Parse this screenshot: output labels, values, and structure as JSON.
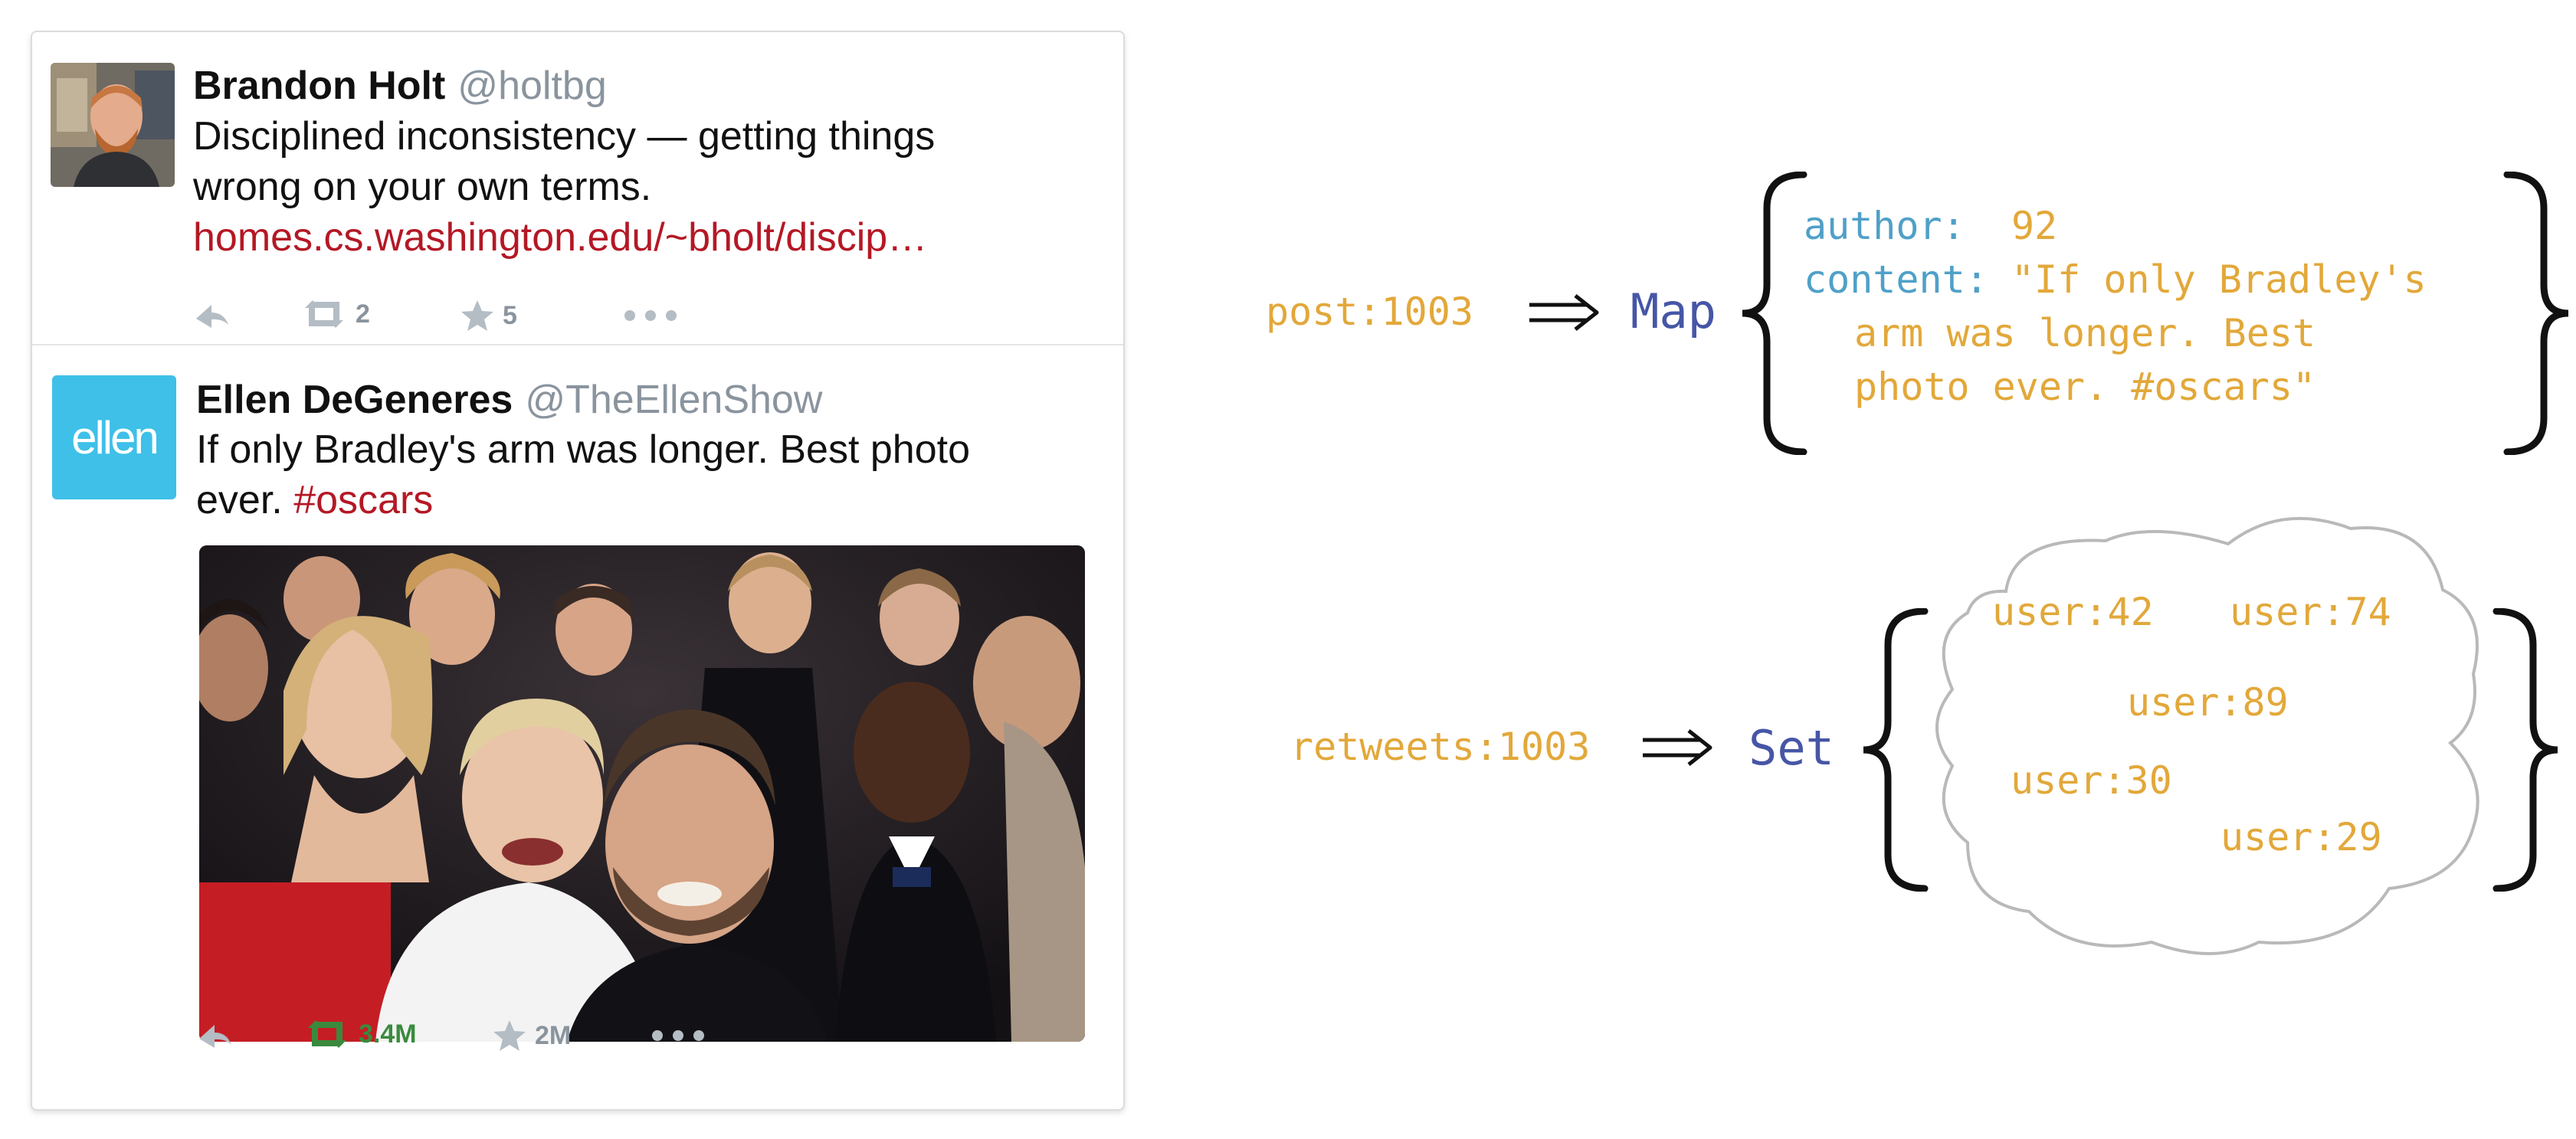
{
  "tweets": [
    {
      "name": "Brandon Holt",
      "handle": "@holtbg",
      "text_line1": "Disciplined inconsistency — getting things",
      "text_line2": "wrong on your own terms.",
      "link": "homes.cs.washington.edu/~bholt/discip…",
      "retweets": "2",
      "favorites": "5"
    },
    {
      "name": "Ellen DeGeneres",
      "handle": "@TheEllenShow",
      "avatar_label": "ellen",
      "text_line1": "If only Bradley's arm was longer. Best photo",
      "text_line2_prefix": "ever.",
      "hashtag": "#oscars",
      "retweets": "3.4M",
      "favorites": "2M"
    }
  ],
  "diagram": {
    "post": {
      "key": "post:1003",
      "type": "Map",
      "fields": [
        {
          "key": "author:",
          "value": "92"
        },
        {
          "key": "content:",
          "value": "\"If only Bradley's"
        }
      ],
      "continuation": [
        "arm was longer. Best",
        "photo ever. #oscars\""
      ]
    },
    "retweets": {
      "key": "retweets:1003",
      "type": "Set",
      "members": [
        "user:42",
        "user:74",
        "user:89",
        "user:30",
        "user:29"
      ]
    }
  },
  "colors": {
    "key": "#e2a83a",
    "type": "#4656a6",
    "field_key": "#4fa0c8",
    "link": "#b41825",
    "retweet_active": "#3a8a3e",
    "action_icon": "#b4bcc4"
  },
  "icons": [
    "reply-icon",
    "retweet-icon",
    "star-icon",
    "more-icon",
    "implies-arrow-icon"
  ]
}
